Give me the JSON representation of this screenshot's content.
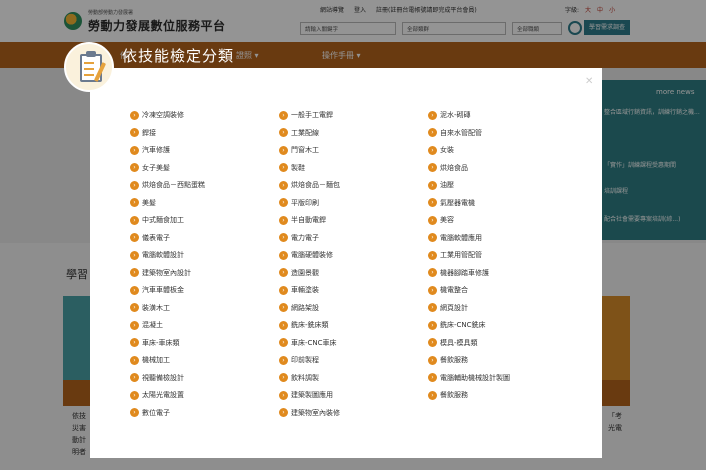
{
  "site": {
    "subtitle": "勞動部勞動力發展署",
    "title": "勞動力發展數位服務平台",
    "top_links": [
      "網站導覽",
      "登入",
      "註冊(註冊台電帳號請即完成平台會員)"
    ],
    "font_size_label": "字級:",
    "font_sizes": [
      "大",
      "中",
      "小"
    ],
    "search_placeholder": "請輸入關鍵字",
    "filter_1": "全部類群",
    "filter_2": "全部職類",
    "learn_button": "學習需求調查"
  },
  "nav": {
    "items": [
      "依",
      "證照 ▾",
      "操作手冊 ▾"
    ]
  },
  "news": {
    "label": "more news",
    "items": [
      "整合區域行銷資訊，訓練行銷之機...",
      "「實作」訓練課程受惠期間",
      "培訓課程",
      "配合社會需要專案培訓(綜...)"
    ]
  },
  "learn_section": {
    "title": "學習"
  },
  "bottom": {
    "left": [
      "依技",
      "災害",
      "動計",
      "明者"
    ],
    "right": [
      "「考",
      "光電"
    ]
  },
  "modal": {
    "title": "依技能檢定分類",
    "close_icon": "close-icon",
    "columns": [
      [
        "冷凍空調裝修",
        "銲接",
        "汽車修護",
        "女子美髮",
        "烘焙食品－西點蛋糕",
        "美髮",
        "中式麵食加工",
        "儀表電子",
        "電腦軟體設計",
        "建築物室內設計",
        "汽車車體板金",
        "裝潢木工",
        "混凝土",
        "車床-車床類",
        "機械加工",
        "視聽備檢設計",
        "太陽光電設置",
        "數位電子"
      ],
      [
        "一般手工電銲",
        "工業配線",
        "門窗木工",
        "製鞋",
        "烘焙食品－麵包",
        "平版印刷",
        "半自動電銲",
        "電力電子",
        "電腦硬體裝修",
        "造園景觀",
        "車輛塗裝",
        "網路架設",
        "銑床-銑床類",
        "車床-CNC車床",
        "印前製程",
        "飲料調製",
        "建築製圖應用",
        "建築物室內裝修"
      ],
      [
        "泥水-砌磚",
        "自來水管配管",
        "女裝",
        "烘焙食品",
        "油壓",
        "氣壓器電機",
        "美容",
        "電腦軟體應用",
        "工業用管配管",
        "機器腳踏車修護",
        "機電整合",
        "網頁設計",
        "銑床-CNC銑床",
        "模具-模具類",
        "餐飲服務",
        "電腦輔助機械設計製圖",
        "餐飲服務"
      ]
    ]
  }
}
